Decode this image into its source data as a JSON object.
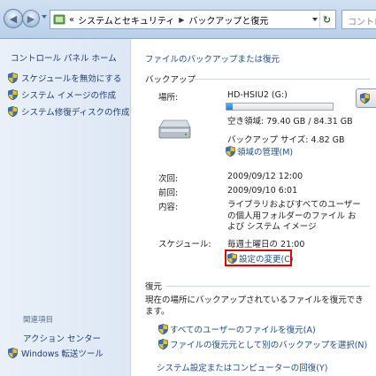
{
  "address_bar": {
    "crumbs": [
      "システムとセキュリティ",
      "バックアップと復元"
    ],
    "search_placeholder": "コントロール"
  },
  "left_pane": {
    "home": "コントロール パネル ホーム",
    "links": [
      "スケジュールを無効にする",
      "システム イメージの作成",
      "システム修復ディスクの作成"
    ],
    "see_also_heading": "関連項目",
    "see_also": [
      "アクション センター",
      "Windows 転送ツール"
    ]
  },
  "main": {
    "title": "ファイルのバックアップまたは復元",
    "backup": {
      "heading": "バックアップ",
      "location_label": "場所:",
      "location_value": "HD-HSIU2 (G:)",
      "free_space": "空き領域: 79.40 GB / 84.31 GB",
      "used_fraction": 0.06,
      "size": "バックアップ サイズ: 4.82 GB",
      "manage_link": "領域の管理(M)",
      "next_label": "次回:",
      "next_value": "2009/09/12 12:00",
      "last_label": "前回:",
      "last_value": "2009/09/10 6:01",
      "contents_label": "内容:",
      "contents_lines": [
        "ライブラリおよびすべてのユーザー",
        "の個人用フォルダーのファイル お",
        "よび システム イメージ"
      ],
      "schedule_label": "スケジュール:",
      "schedule_value": "毎週土曜日の 21:00",
      "change_settings": "設定の変更(C)"
    },
    "restore": {
      "heading": "復元",
      "description": "現在の場所にバックアップされているファイルを復元できます。",
      "link_all_users": "すべてのユーザーのファイルを復元(A)",
      "link_select_other": "ファイルの復元元として別のバックアップを選択(N)",
      "link_system": "システム設定またはコンピューターの回復(Y)"
    }
  },
  "colors": {
    "link": "#1e4e8c",
    "highlight": "#e00000",
    "pane_bg": "#e6eef8"
  }
}
